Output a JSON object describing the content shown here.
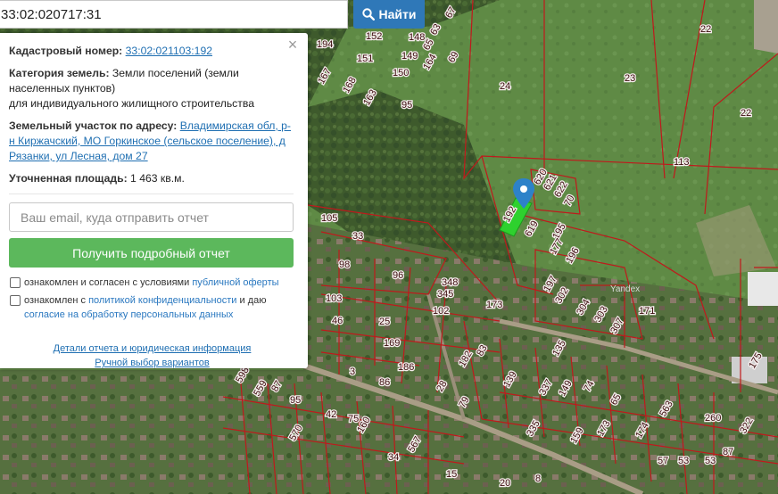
{
  "search": {
    "value": "33:02:020717:31",
    "button_label": "Найти"
  },
  "panel": {
    "cadastral_label": "Кадастровый номер:",
    "cadastral_value": "33:02:021103:192",
    "category_label": "Категория земель:",
    "category_value": "Земли поселений (земли населенных пунктов)",
    "category_use": "для индивидуального жилищного строительства",
    "address_label": "Земельный участок по адресу:",
    "address_value": "Владимирская обл, р-н Киржачский, МО Горкинское (сельское поселение), д Рязанки, ул Лесная, дом 27",
    "area_label": "Уточненная площадь:",
    "area_value": "1 463 кв.м.",
    "email_placeholder": "Ваш email, куда отправить отчет",
    "report_button": "Получить подробный отчет",
    "consent1_prefix": "ознакомлен и согласен с условиями",
    "consent1_link": "публичной оферты",
    "consent2_prefix": "ознакомлен с",
    "consent2_link": "политикой конфиденциальности",
    "consent2_mid": "и даю",
    "consent2_link2": "согласие на обработку персональных данных",
    "footer_link1": "Детали отчета и юридическая информация",
    "footer_link2": "Ручной выбор вариантов",
    "close_icon": "×"
  },
  "map": {
    "highlighted_plot_label": "192",
    "watermark": "Yandex",
    "colors": {
      "boundary": "#c0191c",
      "highlight": "#2ed12e",
      "marker": "#2d82c9"
    },
    "plot_labels": [
      "67",
      "63",
      "152",
      "148",
      "65",
      "194",
      "69",
      "151",
      "149",
      "164",
      "150",
      "167",
      "24",
      "168",
      "163",
      "95",
      "23",
      "22",
      "22",
      "113",
      "105",
      "33",
      "98",
      "96",
      "348",
      "345",
      "102",
      "103",
      "46",
      "25",
      "169",
      "173",
      "302",
      "304",
      "303",
      "307",
      "171",
      "197",
      "195",
      "177",
      "196",
      "619",
      "620",
      "621",
      "622",
      "70",
      "3",
      "186",
      "86",
      "28",
      "182",
      "83",
      "79",
      "139",
      "337",
      "149",
      "135",
      "74",
      "65",
      "563",
      "260",
      "322",
      "175",
      "598",
      "559",
      "87",
      "95",
      "42",
      "75",
      "570",
      "160",
      "567",
      "34",
      "15",
      "20",
      "8",
      "57",
      "53",
      "87",
      "53",
      "174",
      "159",
      "173",
      "335"
    ]
  }
}
